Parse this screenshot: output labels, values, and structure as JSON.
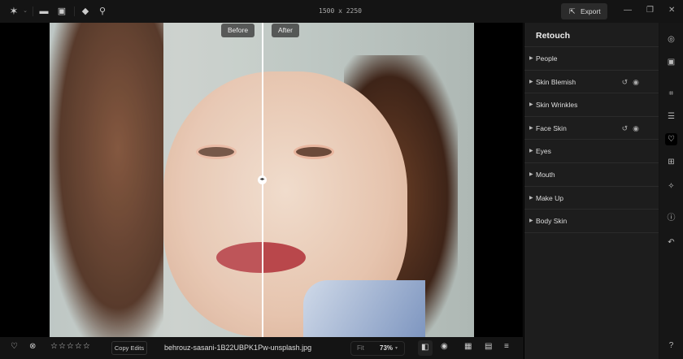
{
  "topbar": {
    "dimensions": "1500 x 2250",
    "export_label": "Export",
    "icons": [
      "logo-star-icon",
      "chevron-down-icon",
      "folder-icon",
      "import-image-icon",
      "eraser-icon",
      "zoom-icon"
    ],
    "window_controls": [
      "minimize",
      "restore",
      "close"
    ]
  },
  "canvas": {
    "before_label": "Before",
    "after_label": "After"
  },
  "panel": {
    "title": "Retouch",
    "items": [
      {
        "label": "People",
        "actions": false
      },
      {
        "label": "Skin Blemish",
        "actions": true
      },
      {
        "label": "Skin Wrinkles",
        "actions": false
      },
      {
        "label": "Face Skin",
        "actions": true
      },
      {
        "label": "Eyes",
        "actions": false
      },
      {
        "label": "Mouth",
        "actions": false
      },
      {
        "label": "Make Up",
        "actions": false
      },
      {
        "label": "Body Skin",
        "actions": false
      }
    ],
    "reset_icon": "↺",
    "eye_icon": "◉"
  },
  "bottom": {
    "copy_edits": "Copy Edits",
    "filename": "behrouz-sasani-1B22UBPK1Pw-unsplash.jpg",
    "fit": "Fit",
    "zoom": "73%",
    "rating": 0,
    "stars": "☆☆☆☆☆"
  },
  "colors": {
    "background": "#121212",
    "panel": "#1d1d1d",
    "accent": "#ffffff"
  }
}
